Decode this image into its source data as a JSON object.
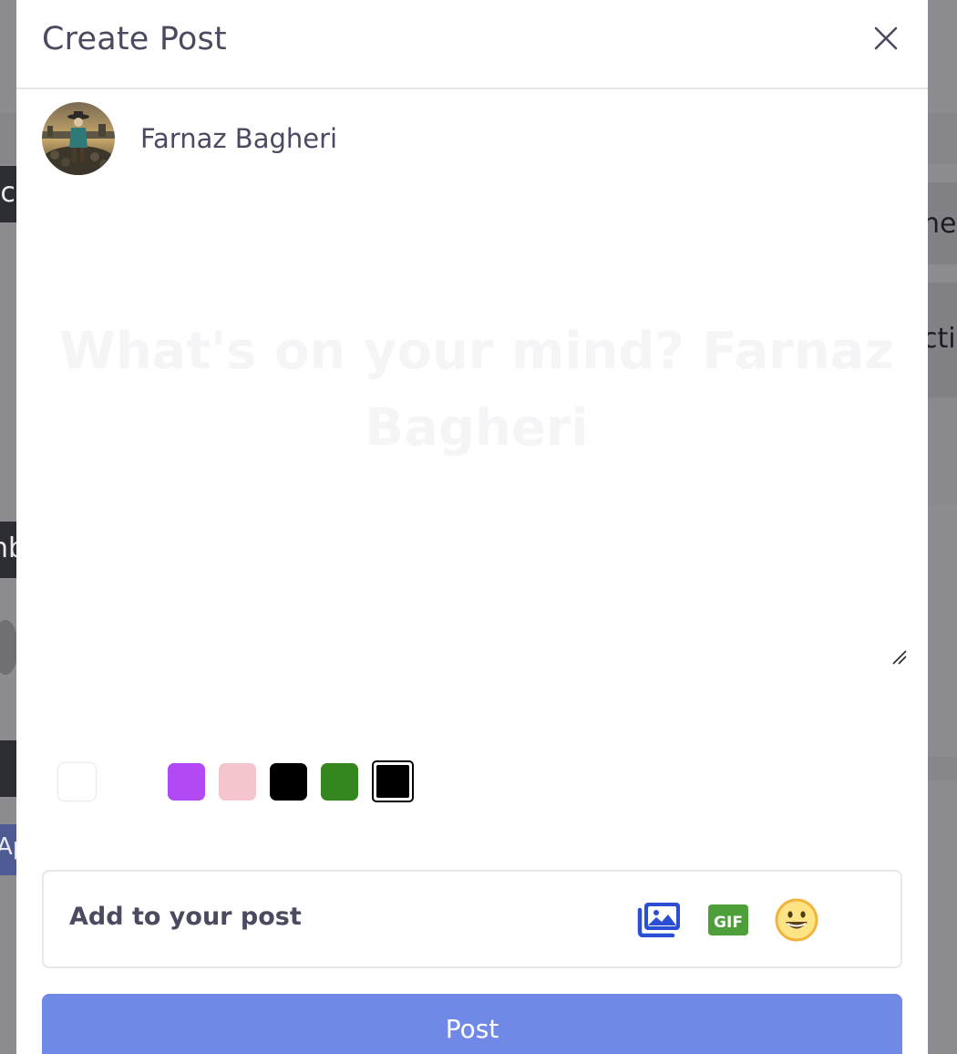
{
  "modal": {
    "title": "Create Post",
    "user_name": "Farnaz Bagheri",
    "textarea_placeholder": "What's on your mind? Farnaz Bagheri",
    "add_to_post_label": "Add to your post",
    "post_button_label": "Post",
    "colors": [
      "#ffffff",
      "#b14af5",
      "#f5c5cd",
      "#000000",
      "#34861f",
      "#000000"
    ],
    "selected_color": "#000000",
    "icons": {
      "close": "close-icon",
      "photo": "photo-gallery-icon",
      "gif": "gif-icon",
      "emoji": "smiley-emoji-icon"
    }
  },
  "background": {
    "partial_texts": [
      "ic",
      "ne",
      "cti",
      "nb",
      "Ap"
    ]
  }
}
